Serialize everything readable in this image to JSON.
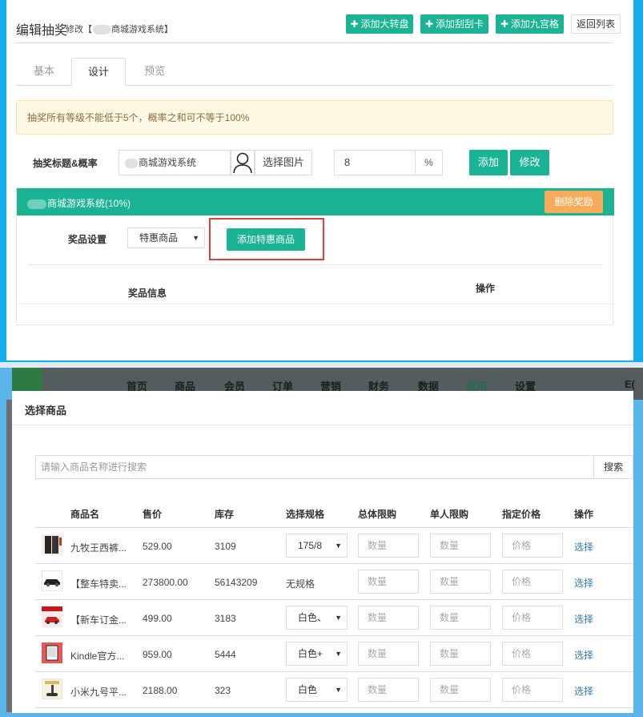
{
  "header": {
    "title": "编辑抽奖",
    "subtitle_prefix": "修改【",
    "subtitle_name": "商城游戏系统",
    "subtitle_suffix": "】",
    "buttons": [
      "添加大转盘",
      "添加刮刮卡",
      "添加九宫格"
    ],
    "back_label": "返回列表"
  },
  "tabs": [
    "基本",
    "设计",
    "预览"
  ],
  "active_tab": "设计",
  "notice": "抽奖所有等级不能低于5个，概率之和可不等于100%",
  "form": {
    "label": "抽奖标题&概率",
    "title_value": "商城游戏系统",
    "choose_image_label": "选择图片",
    "probability_value": "8",
    "percent_symbol": "%",
    "add_label": "添加",
    "edit_label": "修改"
  },
  "prize_panel": {
    "heading": "商城游戏系统(10%)",
    "delete_label": "删除奖励",
    "setting_label": "奖品设置",
    "type_selected": "特惠商品",
    "add_special_label": "添加特惠商品",
    "col_info": "奖品信息",
    "col_op": "操作"
  },
  "bg_nav": [
    "首页",
    "商品",
    "会员",
    "订单",
    "营销",
    "财务",
    "数据",
    "应用",
    "设置"
  ],
  "bg_nav_active": "应用",
  "bg_nav_right": "E(",
  "modal": {
    "title": "选择商品",
    "search_placeholder": "请输入商品名称进行搜索",
    "search_button": "搜索",
    "columns": [
      "商品名",
      "售价",
      "库存",
      "选择规格",
      "总体限购",
      "单人限购",
      "指定价格",
      "操作"
    ],
    "qty_placeholder": "数量",
    "price_placeholder": "价格",
    "select_label": "选择",
    "rows": [
      {
        "name": "九牧王西裤...",
        "price": "529.00",
        "stock": "3109",
        "spec": "175/8",
        "spec_type": "select",
        "thumb": "pants"
      },
      {
        "name": "【整车特卖...",
        "price": "273800.00",
        "stock": "56143209",
        "spec": "无规格",
        "spec_type": "text",
        "thumb": "car"
      },
      {
        "name": "【新车订金...",
        "price": "499.00",
        "stock": "3183",
        "spec": "白色、",
        "spec_type": "select",
        "thumb": "redcar"
      },
      {
        "name": "Kindle官方...",
        "price": "959.00",
        "stock": "5444",
        "spec": "白色+",
        "spec_type": "select",
        "thumb": "kindle"
      },
      {
        "name": "小米九号平...",
        "price": "2188.00",
        "stock": "323",
        "spec": "白色",
        "spec_type": "select",
        "thumb": "scooter"
      }
    ]
  },
  "colors": {
    "primary_green": "#1ab394",
    "warning_orange": "#f8ac59",
    "highlight_red": "#e43b3b",
    "link_blue": "#337ab7",
    "frame_blue": "#13aef0"
  }
}
